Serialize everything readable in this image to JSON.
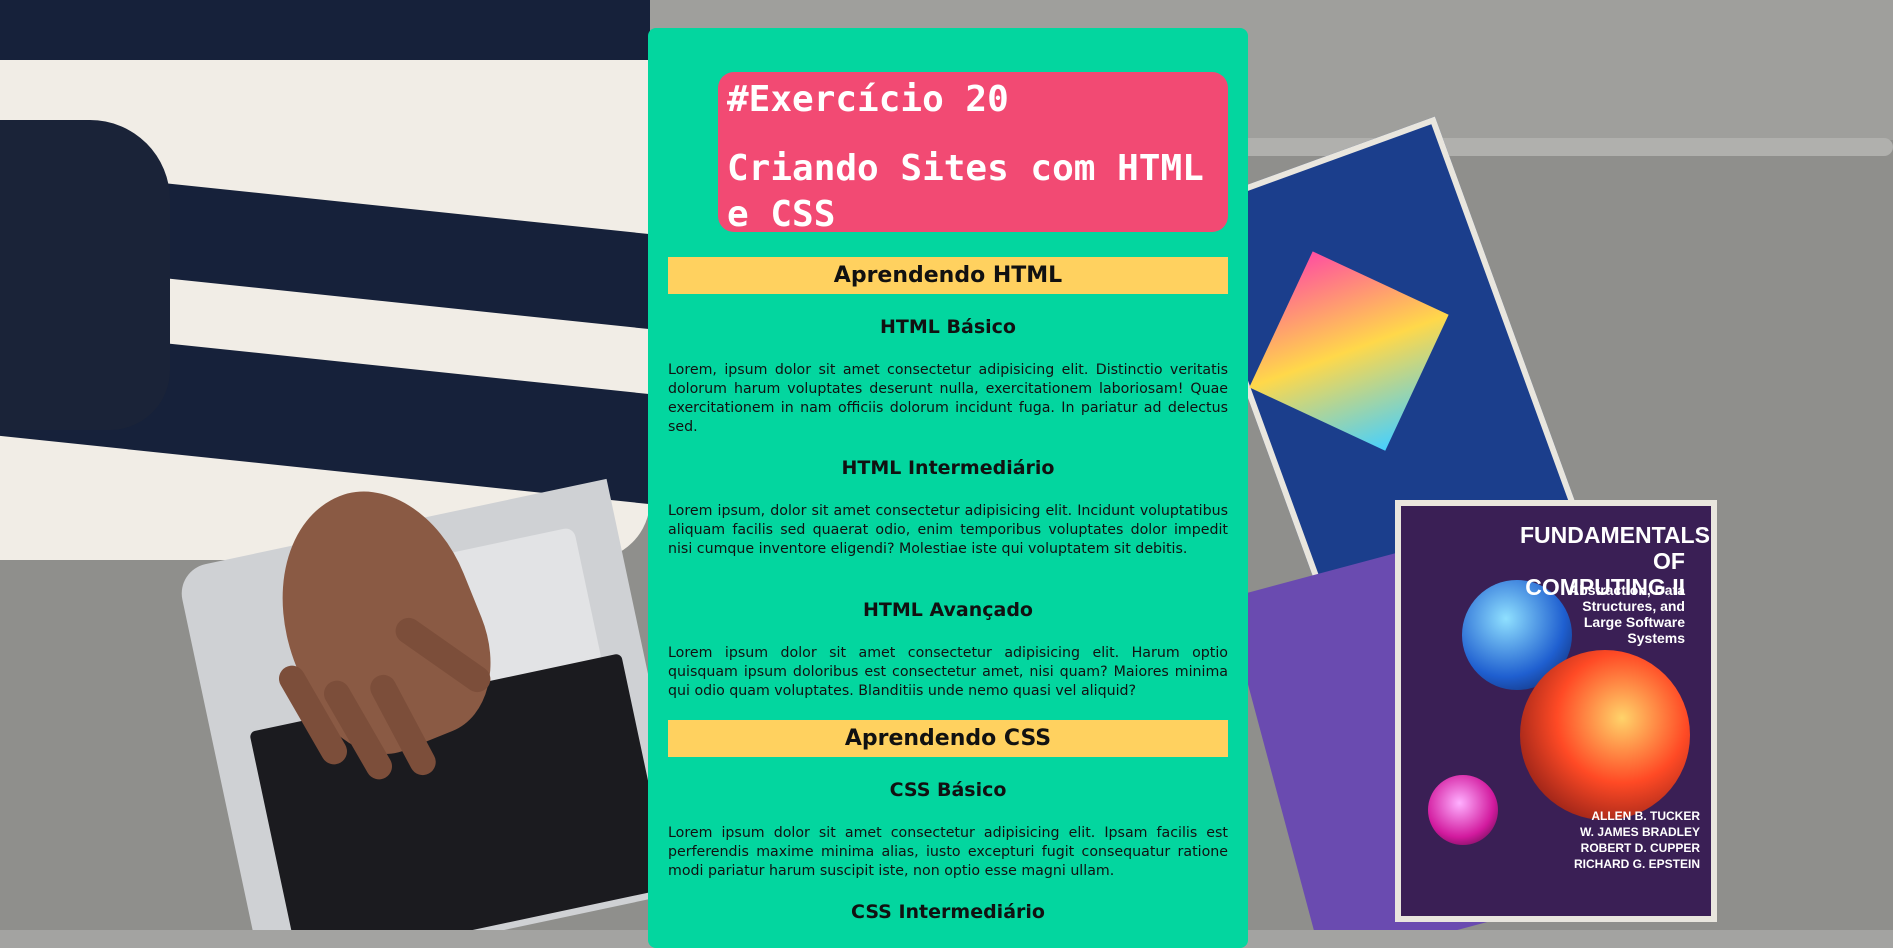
{
  "header": {
    "kicker": "#Exercício 20",
    "title": "Criando Sites com HTML e CSS"
  },
  "sections": [
    {
      "heading": "Aprendendo HTML",
      "topics": [
        {
          "title": "HTML Básico",
          "text": "Lorem, ipsum dolor sit amet consectetur adipisicing elit. Distinctio veritatis dolorum harum voluptates deserunt nulla, exercitationem laboriosam! Quae exercitationem in nam officiis dolorum incidunt fuga. In pariatur ad delectus sed."
        },
        {
          "title": "HTML Intermediário",
          "text": "Lorem ipsum, dolor sit amet consectetur adipisicing elit. Incidunt voluptatibus aliquam facilis sed quaerat odio, enim temporibus voluptates dolor impedit nisi cumque inventore eligendi? Molestiae iste qui voluptatem sit debitis."
        },
        {
          "title": "HTML Avançado",
          "text": "Lorem ipsum dolor sit amet consectetur adipisicing elit. Harum optio quisquam ipsum doloribus est consectetur amet, nisi quam? Maiores minima qui odio quam voluptates. Blanditiis unde nemo quasi vel aliquid?"
        }
      ]
    },
    {
      "heading": "Aprendendo CSS",
      "topics": [
        {
          "title": "CSS Básico",
          "text": "Lorem ipsum dolor sit amet consectetur adipisicing elit. Ipsam facilis est perferendis maxime minima alias, iusto excepturi fugit consequatur ratione modi pariatur harum suscipit iste, non optio esse magni ullam."
        },
        {
          "title": "CSS Intermediário",
          "text": ""
        }
      ]
    }
  ],
  "background_image": {
    "book_title": "FUNDAMENTALS OF COMPUTING II",
    "book_subtitle": "Abstraction, Data Structures, and Large Software Systems",
    "book_authors": [
      "ALLEN B. TUCKER",
      "W. JAMES BRADLEY",
      "ROBERT D. CUPPER",
      "RICHARD G. EPSTEIN"
    ]
  },
  "colors": {
    "card_bg": "#03d69f",
    "header_bg": "#f24a73",
    "section_bar_bg": "#ffd15f",
    "text": "#111111"
  }
}
